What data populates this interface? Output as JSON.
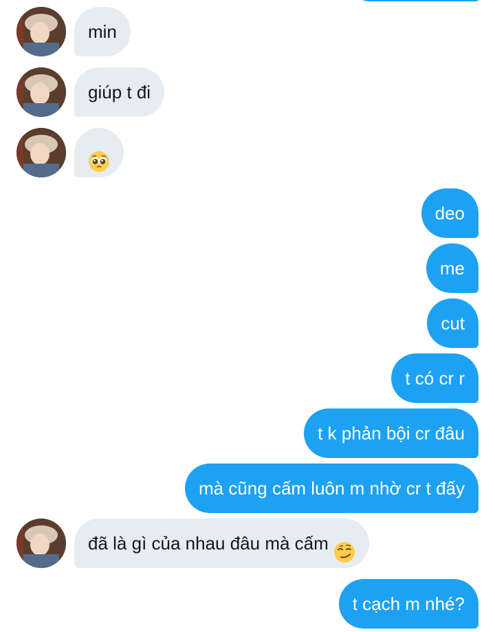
{
  "colors": {
    "incoming_bubble": "#e6ecf0",
    "incoming_text": "#14171a",
    "outgoing_bubble": "#1da1f2",
    "outgoing_text": "#ffffff"
  },
  "messages": [
    {
      "sender": "other",
      "text": "min"
    },
    {
      "sender": "other",
      "text": "giúp t đi"
    },
    {
      "sender": "other",
      "text": "",
      "emoji": "pleading-face-emoji"
    },
    {
      "sender": "me",
      "text": "deo"
    },
    {
      "sender": "me",
      "text": "me"
    },
    {
      "sender": "me",
      "text": "cut"
    },
    {
      "sender": "me",
      "text": "t có cr r"
    },
    {
      "sender": "me",
      "text": "t k phản bội cr đâu"
    },
    {
      "sender": "me",
      "text": "mà cũng cấm luôn m nhờ cr t đấy"
    },
    {
      "sender": "other",
      "text": "đã là gì của nhau đâu mà cấm ",
      "emoji": "smirking-face-emoji"
    },
    {
      "sender": "me",
      "text": "t cạch m nhé?"
    }
  ]
}
